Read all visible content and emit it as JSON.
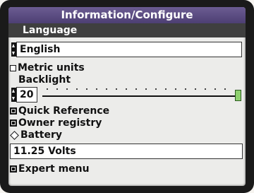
{
  "window": {
    "title": "Information/Configure"
  },
  "language": {
    "header": "Language",
    "value": "English"
  },
  "metric_units": {
    "label": "Metric units",
    "checked": false
  },
  "backlight": {
    "label": "Backlight",
    "value": "20",
    "level_percent": 100
  },
  "menu": {
    "quick_reference": "Quick Reference",
    "owner_registry": "Owner registry",
    "battery": "Battery"
  },
  "battery_reading": "11.25 Volts",
  "expert_menu": "Expert menu",
  "colors": {
    "title_bar": "#5a4b80",
    "slider_thumb": "#8ed06e"
  }
}
